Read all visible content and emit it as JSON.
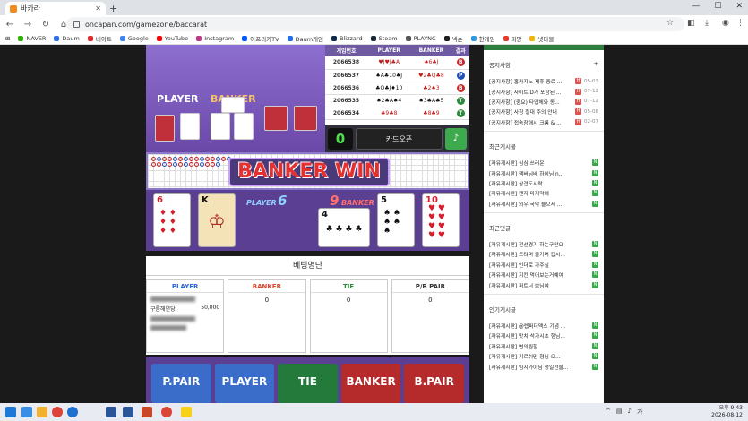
{
  "browser": {
    "tab_title": "바카라",
    "url": "oncapan.com/gamezone/baccarat",
    "bookmarks": [
      "NAVER",
      "Daum",
      "네이트",
      "Google",
      "YouTube",
      "Instagram",
      "아프리카TV",
      "Daum게임",
      "Blizzard",
      "Steam",
      "PLAYNC",
      "넥슨",
      "한게임",
      "피망",
      "넷마블"
    ]
  },
  "game": {
    "player_label": "PLAYER",
    "banker_label": "BANKER",
    "history_headers": [
      "게임번호",
      "PLAYER",
      "BANKER",
      "결과"
    ],
    "history_rows": [
      {
        "id": "2066538",
        "player": "♥J♥J♣A",
        "banker": "♠6♣J",
        "result": "B"
      },
      {
        "id": "2066537",
        "player": "♠A♣10♠J",
        "banker": "♥2♣Q♣8",
        "result": "P"
      },
      {
        "id": "2066536",
        "player": "♣Q♣J♦10",
        "banker": "♣2♠3",
        "result": "B"
      },
      {
        "id": "2066535",
        "player": "♠2♣A♠4",
        "banker": "♠3♣A♣5",
        "result": "T"
      },
      {
        "id": "2066534",
        "player": "♣9♣8",
        "banker": "♣8♣9",
        "result": "T"
      }
    ],
    "counter": "0",
    "card_open_label": "카드오픈",
    "win_text": "BANKER WIN",
    "player_score_label": "PLAYER",
    "player_score": "6",
    "banker_score_label": "BANKER",
    "banker_score": "9"
  },
  "bets": {
    "title": "베팅명단",
    "columns": [
      {
        "name": "PLAYER",
        "value": ""
      },
      {
        "name": "BANKER",
        "value": "0"
      },
      {
        "name": "TIE",
        "value": "0"
      },
      {
        "name": "P/B PAIR",
        "value": "0"
      }
    ],
    "player_entry_name": "구름해연당",
    "player_entry_amount": "50,000"
  },
  "betboard": [
    "P.PAIR",
    "PLAYER",
    "TIE",
    "BANKER",
    "B.PAIR"
  ],
  "sidebar": {
    "notices_title": "공지사항",
    "notices": [
      {
        "text": "[공지사항] 홈카지노 재휴 종료 ...",
        "date": "05-03"
      },
      {
        "text": "[공지사항] 사이트ID가 포함된 ...",
        "date": "07-12"
      },
      {
        "text": "[공지사항] (중요) 타업체와 동...",
        "date": "07-12"
      },
      {
        "text": "[공지사항] 사칭 절대 주의 안내",
        "date": "05-08"
      },
      {
        "text": "[공지사항] 접속장애시 크롬 & ...",
        "date": "02-07"
      }
    ],
    "recent_posts_title": "최근게시물",
    "recent_posts": [
      "[자유게시판] 심심 쓰러운",
      "[자유게시판] 햄버님배 하이님 n...",
      "[자유게시판] 삼겹도시락",
      "[자유게시판] 캔지 마지막에",
      "[자유게시판] 외우 국악 을으세 ..."
    ],
    "recent_comments_title": "최근댓글",
    "recent_comments": [
      "[자유게시판] 천선경기 하는구만요",
      "[자유게시판] 드려머 줄기며 갑시...",
      "[자유게시판] 인더로 가주실",
      "[자유게시판] 지킨 먹어보는거예여",
      "[자유게시판] 퍼트너 보님여"
    ],
    "popular_title": "인기게시글",
    "popular": [
      "[자유게시판] @렙퍼더맥스 기념 ...",
      "[자유게시판] 맛치 석가시초 행님...",
      "[자유게시판] 변의원함",
      "[자유게시판] 기르쉬만 형님 오...",
      "[자유게시판] 임시가야님 생일선물..."
    ]
  },
  "taskbar": {
    "time": "오후 9:43",
    "date": "2026-08-12"
  }
}
